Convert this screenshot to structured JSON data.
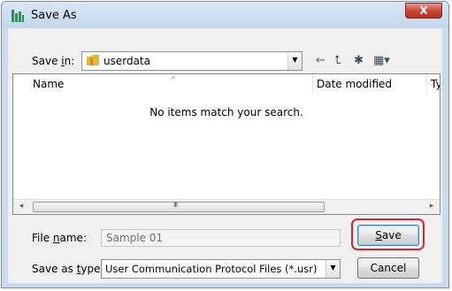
{
  "window": {
    "title": "Save As",
    "close_glyph": "X"
  },
  "save_in": {
    "label_before": "Save ",
    "label_accel": "i",
    "label_after": "n:",
    "value": "userdata"
  },
  "toolbar": {
    "back_glyph": "←",
    "up_glyph": "⮤",
    "new_folder_glyph": "✱",
    "views_glyph": "▦▾"
  },
  "file_list": {
    "columns": [
      "Name",
      "Date modified",
      "Ty"
    ],
    "sort_glyph": "^",
    "empty_message": "No items match your search.",
    "scroll_left": "◂",
    "scroll_right": "▸",
    "scroll_grip": "III"
  },
  "file_name": {
    "label_before": "File ",
    "label_accel": "n",
    "label_after": "ame:",
    "value": "Sample 01"
  },
  "save_as_type": {
    "label_before": "Save as ",
    "label_accel": "t",
    "label_after": "ype:",
    "value": "User Communication Protocol Files (*.usr)"
  },
  "buttons": {
    "save": {
      "accel": "S",
      "rest": "ave"
    },
    "cancel": "Cancel"
  },
  "colors": {
    "highlight": "#d7262b",
    "app_icon": "#1b9d43",
    "folder": "#e8b73a",
    "close_button": "#c8432f"
  },
  "icons": [
    "app-icon",
    "close-icon",
    "folder-icon",
    "back-arrow-icon",
    "up-folder-icon",
    "new-folder-icon",
    "views-menu-icon",
    "sort-ascending-icon",
    "scroll-left-icon",
    "scroll-right-icon",
    "dropdown-arrow-icon"
  ]
}
